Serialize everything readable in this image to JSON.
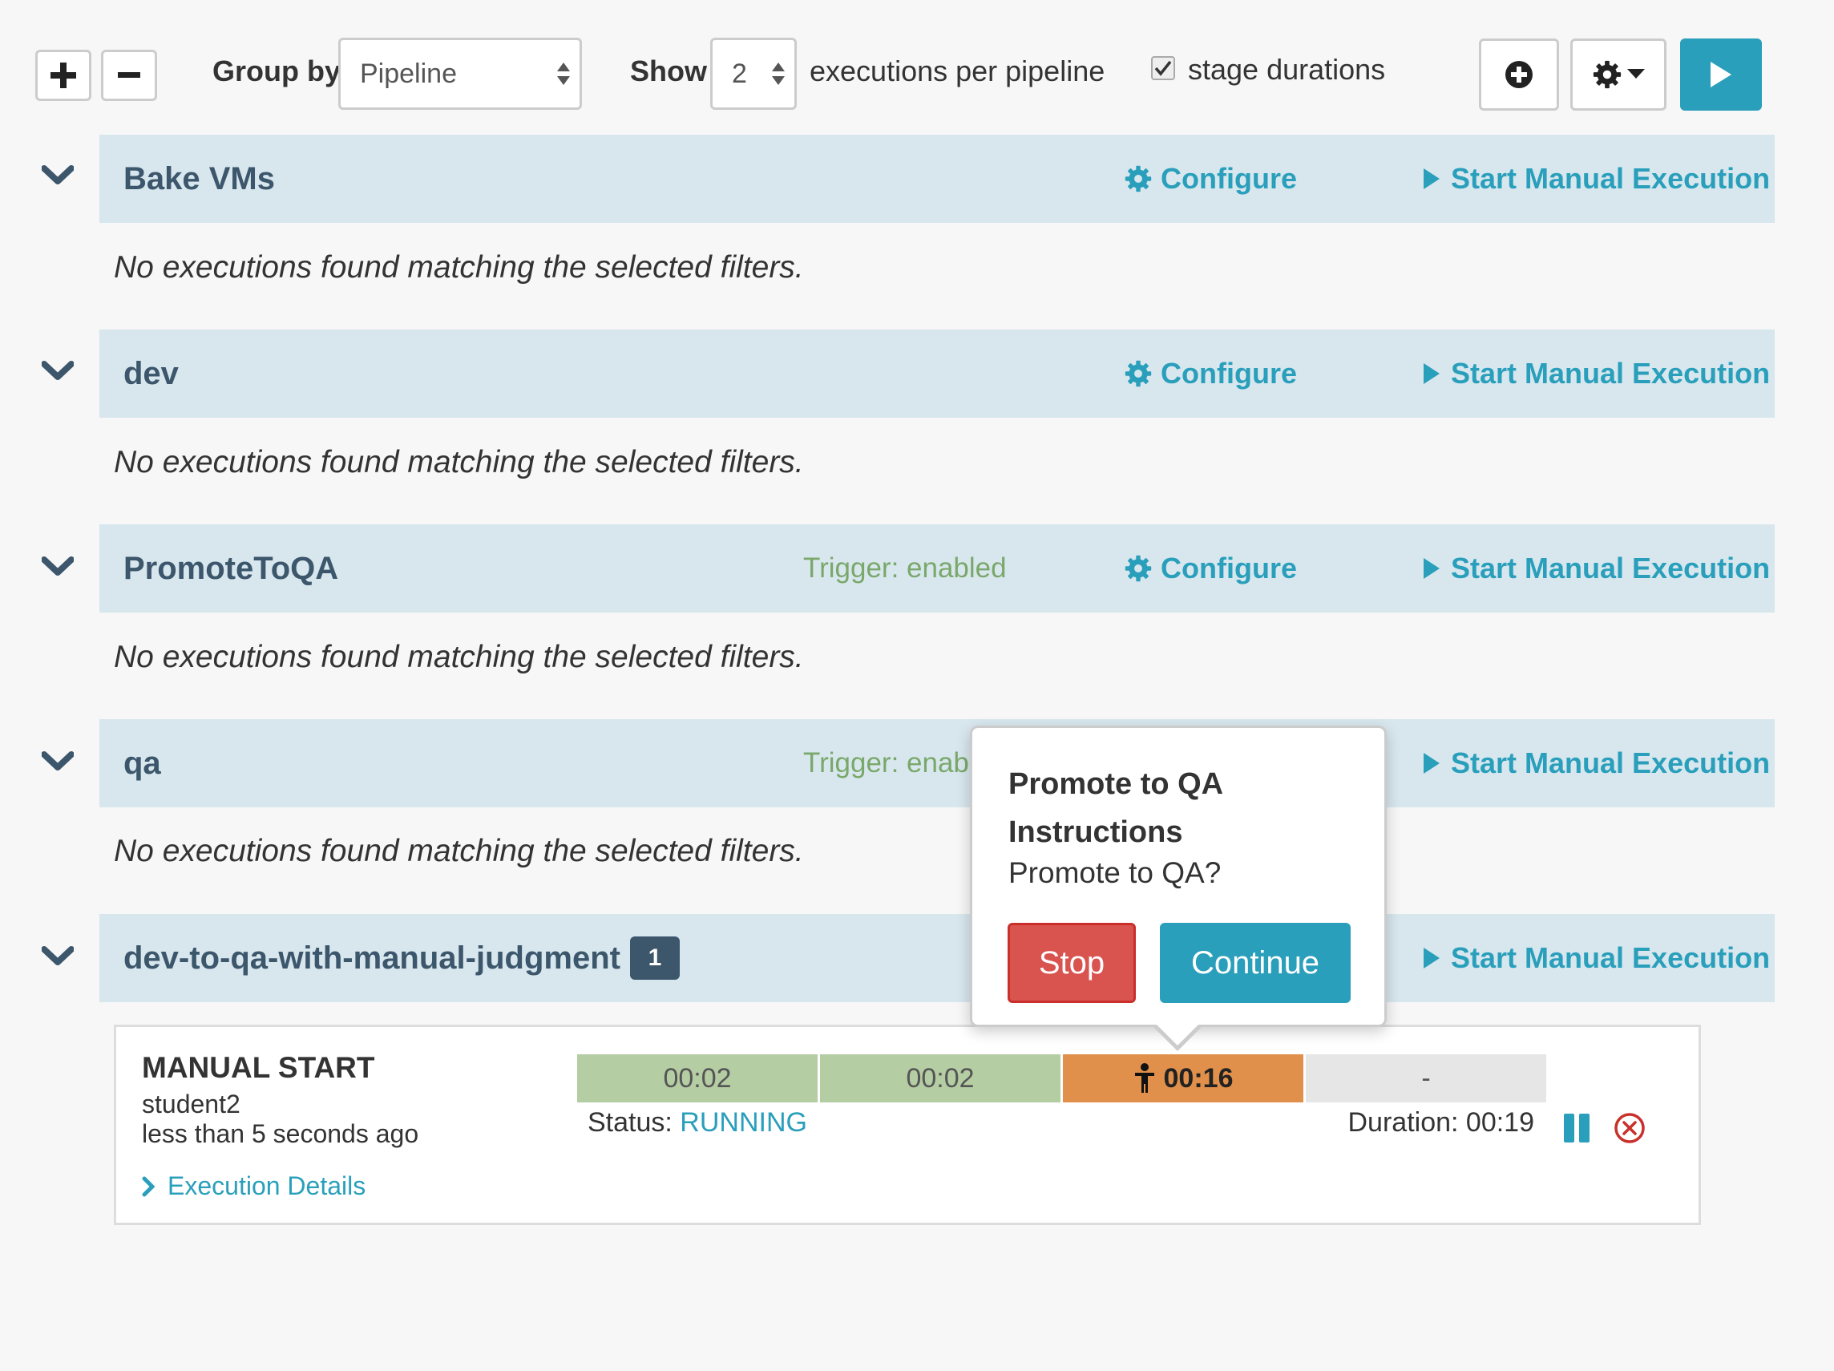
{
  "toolbar": {
    "group_by_label": "Group by",
    "group_by_value": "Pipeline",
    "show_label": "Show",
    "show_count": "2",
    "per_pipeline_text": "executions per pipeline",
    "stage_durations_label": "stage durations",
    "stage_durations_checked": true
  },
  "groups": [
    {
      "name": "Bake VMs",
      "trigger": "",
      "configure": "Configure",
      "start": "Start Manual Execution",
      "empty_text": "No executions found matching the selected filters."
    },
    {
      "name": "dev",
      "trigger": "",
      "configure": "Configure",
      "start": "Start Manual Execution",
      "empty_text": "No executions found matching the selected filters."
    },
    {
      "name": "PromoteToQA",
      "trigger": "Trigger: enabled",
      "configure": "Configure",
      "start": "Start Manual Execution",
      "empty_text": "No executions found matching the selected filters."
    },
    {
      "name": "qa",
      "trigger": "Trigger: enabl",
      "configure": "",
      "start": "Start Manual Execution",
      "empty_text": "No executions found matching the selected filters."
    },
    {
      "name": "dev-to-qa-with-manual-judgment",
      "badge": "1",
      "start": "Start Manual Execution"
    }
  ],
  "execution": {
    "trigger": "MANUAL START",
    "user": "student2",
    "time": "less than 5 seconds ago",
    "details_link": "Execution Details",
    "stages": [
      {
        "label": "00:02",
        "color": "#b5cda3"
      },
      {
        "label": "00:02",
        "color": "#b5cda3"
      },
      {
        "label": "00:16",
        "color": "#e0904a"
      },
      {
        "label": "-",
        "color": "#e6e6e6"
      }
    ],
    "status_label": "Status:",
    "status_value": "RUNNING",
    "duration": "Duration: 00:19"
  },
  "popover": {
    "title": "Promote to QA Instructions",
    "body": "Promote to QA?",
    "stop": "Stop",
    "continue": "Continue"
  },
  "colors": {
    "accent": "#2a9fbb",
    "header_bg": "#d8e7ee",
    "title": "#3c566c",
    "trigger": "#7aa86b",
    "stop": "#d9534f"
  }
}
